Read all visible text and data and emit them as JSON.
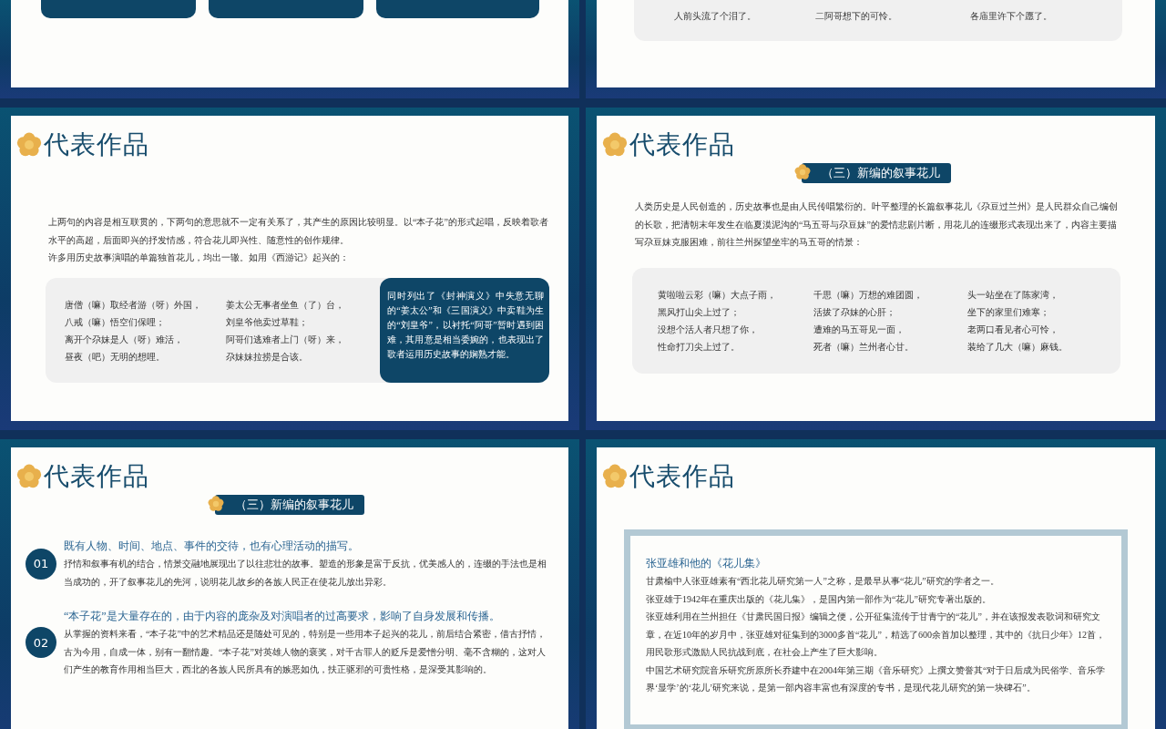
{
  "slides": [
    {
      "kind": "cards"
    },
    {
      "kind": "verses",
      "columns": [
        [
          "人前头流了个泪了。"
        ],
        [
          "二阿哥想下的可怜。"
        ],
        [
          "各庙里许下个愿了。"
        ]
      ]
    },
    {
      "kind": "text_note",
      "title": "代表作品",
      "paragraphs": [
        "上两句的内容是相互联贯的，下两句的意思就不一定有关系了，其产生的原因比较明显。以“本子花”的形式起唱，反映着歌者水平的高超，后面即兴的抒发情感，符合花儿即兴性、随意性的创作规律。",
        "许多用历史故事演唱的单篇独首花儿，均出一辙。如用《西游记》起兴的："
      ],
      "columns": [
        [
          "唐僧（嘛）取经者游（呀）外国，",
          "八戒（嘛）悟空们保哩；",
          "离开个尕妹是人（呀）难活，",
          "昼夜（吧）无明的想哩。"
        ],
        [
          "姜太公无事者坐鱼（了）台，",
          "刘皇爷他卖过草鞋；",
          "阿哥们逃难者上门（呀）来，",
          "尕妹妹拉捞是合该。"
        ]
      ],
      "note": "同时列出了《封神演义》中失意无聊的“姜太公”和《三国演义》中卖鞋为生的“刘皇爷”，以衬托“阿哥”暂时遇到困难，其用意是相当委婉的，也表现出了歌者运用历史故事的娴熟才能。"
    },
    {
      "kind": "badge_verses",
      "title": "代表作品",
      "badge": "（三）新编的叙事花儿",
      "paragraphs": [
        "人类历史是人民创造的，历史故事也是由人民传唱繁衍的。叶平整理的长篇叙事花儿《尕豆过兰州》是人民群众自己编创的长歌，把清朝末年发生在临夏漠泥沟的“马五哥与尕豆妹”的爱情悲剧片断，用花儿的连缀形式表现出来了，内容主要描写尕豆妹克服困难，前往兰州探望坐牢的马五哥的情景："
      ],
      "columns": [
        [
          "黄啦啦云彩（嘛）大点子雨，",
          "黑风打山尖上过了；",
          "没想个活人者只想了你，",
          "性命打刀尖上过了。"
        ],
        [
          "千思（嘛）万想的难团圆，",
          "活拔了尕妹的心肝；",
          "遭难的马五哥见一面，",
          "死者（嘛）兰州者心甘。"
        ],
        [
          "头一站坐在了陈家湾，",
          "坐下的家里们难寒；",
          "老两口看见者心可怜，",
          "装给了几大（嘛）麻钱。"
        ]
      ]
    },
    {
      "kind": "points",
      "title": "代表作品",
      "badge": "（三）新编的叙事花儿",
      "points": [
        {
          "number": "01",
          "heading": "既有人物、时间、地点、事件的交待，也有心理活动的描写。",
          "body": "抒情和叙事有机的结合，情景交融地展现出了以往悲壮的故事。塑造的形象是富于反抗，优美感人的，连缀的手法也是相当成功的，开了叙事花儿的先河，说明花儿故乡的各族人民正在使花儿放出异彩。"
        },
        {
          "number": "02",
          "heading": "“本子花”是大量存在的，由于内容的庞杂及对演唱者的过高要求，影响了自身发展和传播。",
          "body": "从掌握的资料来看，“本子花”中的艺术精品还是随处可见的，特别是一些用本子起兴的花儿，前后结合紧密，借古抒情，古为今用，自成一体，别有一翻情趣。“本子花”对英雄人物的褒奖，对千古罪人的贬斥是爱憎分明、毫不含糊的，这对人们产生的教育作用相当巨大，西北的各族人民所具有的嫉恶如仇，扶正驱邪的可贵性格，是深受其影响的。"
        }
      ]
    },
    {
      "kind": "framed",
      "title": "代表作品",
      "heading": "张亚雄和他的《花儿集》",
      "paragraphs": [
        "甘肃榆中人张亚雄素有“西北花儿研究第一人”之称，是最早从事“花儿”研究的学者之一。",
        "张亚雄于1942年在重庆出版的《花儿集》，是国内第一部作为“花儿”研究专著出版的。",
        "张亚雄利用在兰州担任《甘肃民国日报》编辑之便，公开征集流传于甘青宁的“花儿”，并在该报发表歌词和研究文章，在近10年的岁月中，张亚雄对征集到的3000多首“花儿”，精选了600余首加以整理，其中的《抗日少年》12首，用民歌形式激励人民抗战到底，在社会上产生了巨大影响。",
        "中国艺术研究院音乐研究所原所长乔建中在2004年第三期《音乐研究》上撰文赞誉其“对于日后成为民俗学、音乐学界‘显学’的‘花儿’研究来说，是第一部内容丰富也有深度的专书，是现代花儿研究的第一块碑石”。"
      ]
    }
  ]
}
